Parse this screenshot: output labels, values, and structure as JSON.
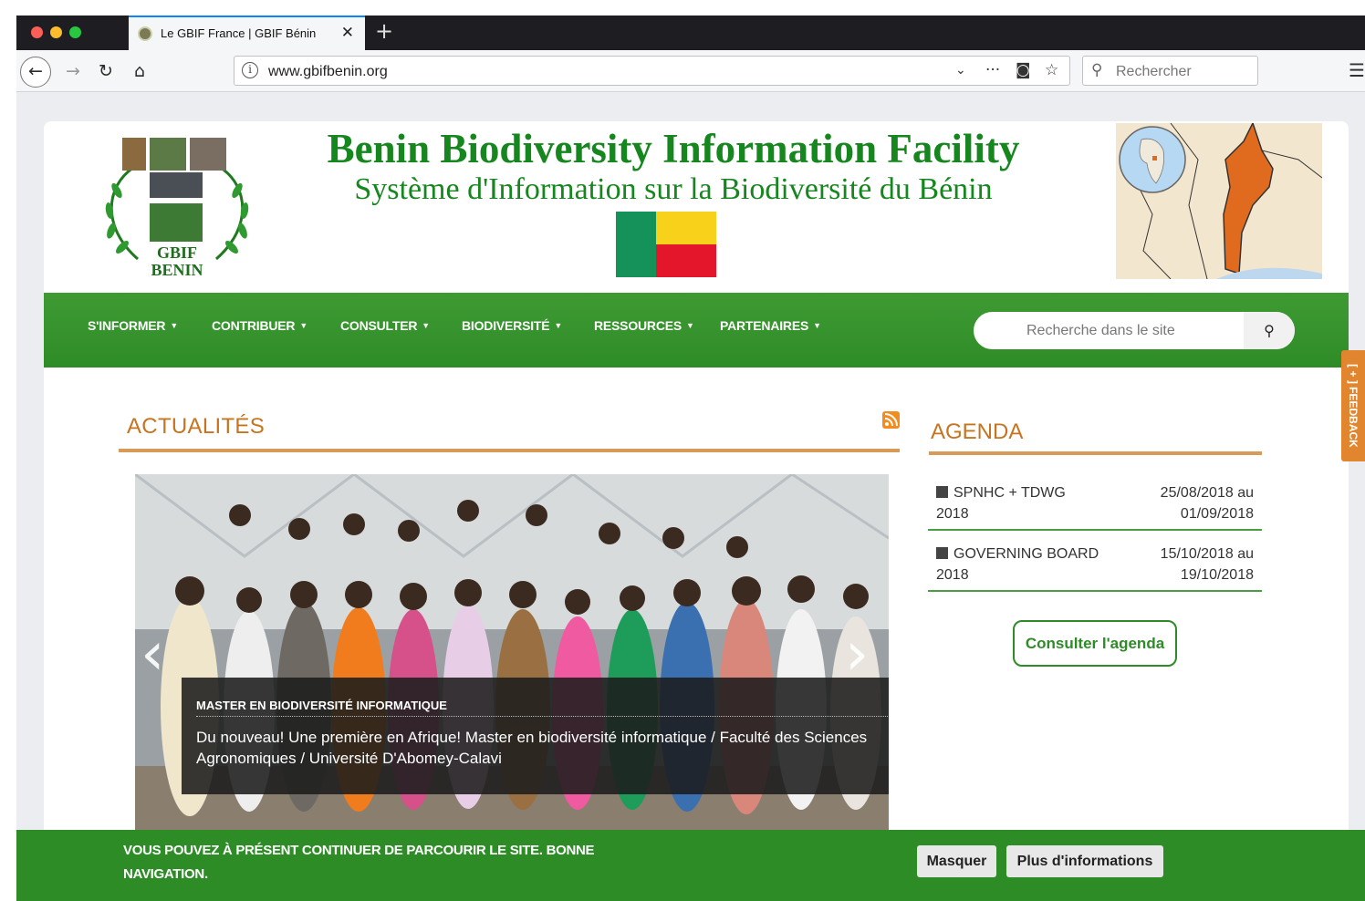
{
  "browser": {
    "tab_title": "Le GBIF France | GBIF Bénin",
    "url": "www.gbifbenin.org",
    "search_placeholder": "Rechercher",
    "icons": [
      "back-icon",
      "forward-icon",
      "reload-icon",
      "home-icon",
      "info-icon",
      "dropdown-icon",
      "more-icon",
      "pocket-icon",
      "bookmark-star-icon",
      "search-icon",
      "menu-icon"
    ]
  },
  "header": {
    "title": "Benin Biodiversity Information Facility",
    "subtitle": "Système d'Information sur la Biodiversité du Bénin",
    "logo_text_line1": "GBIF",
    "logo_text_line2": "BENIN",
    "flag_colors": [
      "#14925a",
      "#f8d21a",
      "#e3162c"
    ]
  },
  "nav": {
    "items": [
      {
        "label": "S'INFORMER"
      },
      {
        "label": "CONTRIBUER"
      },
      {
        "label": "CONSULTER"
      },
      {
        "label": "BIODIVERSITÉ"
      },
      {
        "label": "RESSOURCES"
      },
      {
        "label": "PARTENAIRES"
      }
    ],
    "search_placeholder": "Recherche dans le site"
  },
  "news": {
    "heading": "ACTUALITÉS",
    "slide_title": "MASTER EN BIODIVERSITÉ INFORMATIQUE",
    "slide_text": "Du nouveau! Une première en Afrique! Master en biodiversité informatique / Faculté des Sciences Agronomiques / Université D'Abomey-Calavi"
  },
  "agenda": {
    "heading": "AGENDA",
    "items": [
      {
        "name": "SPNHC + TDWG 2018",
        "date": "25/08/2018 au 01/09/2018"
      },
      {
        "name": "GOVERNING BOARD 2018",
        "date": "15/10/2018 au 19/10/2018"
      }
    ],
    "button": "Consulter l'agenda"
  },
  "feedback_label": "[ + ] FEEDBACK",
  "cookie": {
    "text": "VOUS POUVEZ À PRÉSENT CONTINUER DE PARCOURIR LE SITE. BONNE NAVIGATION.",
    "hide_button": "Masquer",
    "more_button": "Plus d'informations"
  },
  "colors": {
    "brand_green": "#2e8c27",
    "accent_orange": "#c67421"
  }
}
